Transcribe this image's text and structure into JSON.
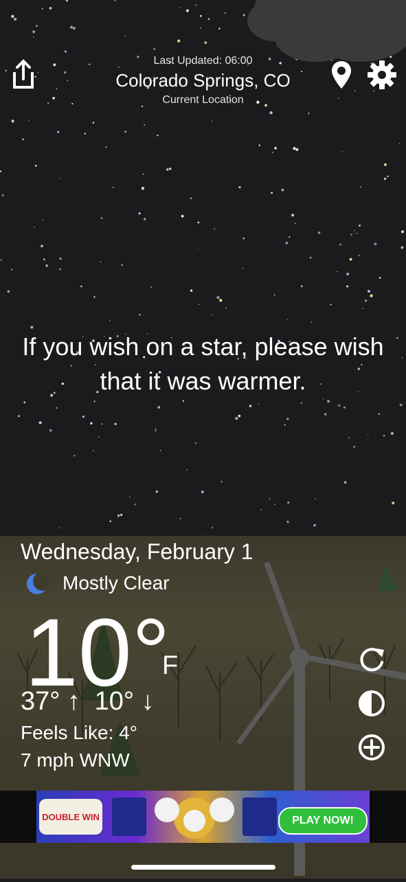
{
  "header": {
    "last_updated": "Last Updated: 06:00",
    "location": "Colorado Springs, CO",
    "location_source": "Current Location"
  },
  "quote": "If you wish on a star, please wish that it was warmer.",
  "weather": {
    "date": "Wednesday, February 1",
    "condition": "Mostly Clear",
    "condition_icon": "moon-icon",
    "temperature": "10°",
    "unit": "F",
    "high": "37°",
    "low": "10°",
    "feels_like": "Feels Like: 4°",
    "wind": "7 mph WNW"
  },
  "actions": {
    "share_icon": "share-icon",
    "location_icon": "location-pin-icon",
    "settings_icon": "gear-icon",
    "refresh_icon": "refresh-icon",
    "theme_icon": "theme-icon",
    "add_icon": "add-icon"
  },
  "ad": {
    "left_text": "DOUBLE WIN",
    "cta": "PLAY NOW!"
  },
  "colors": {
    "sky": "#1b1b1d",
    "ground": "#45412f",
    "text": "#ffffff",
    "moon": "#4a7de0",
    "ad_cta": "#2fbf3a"
  }
}
